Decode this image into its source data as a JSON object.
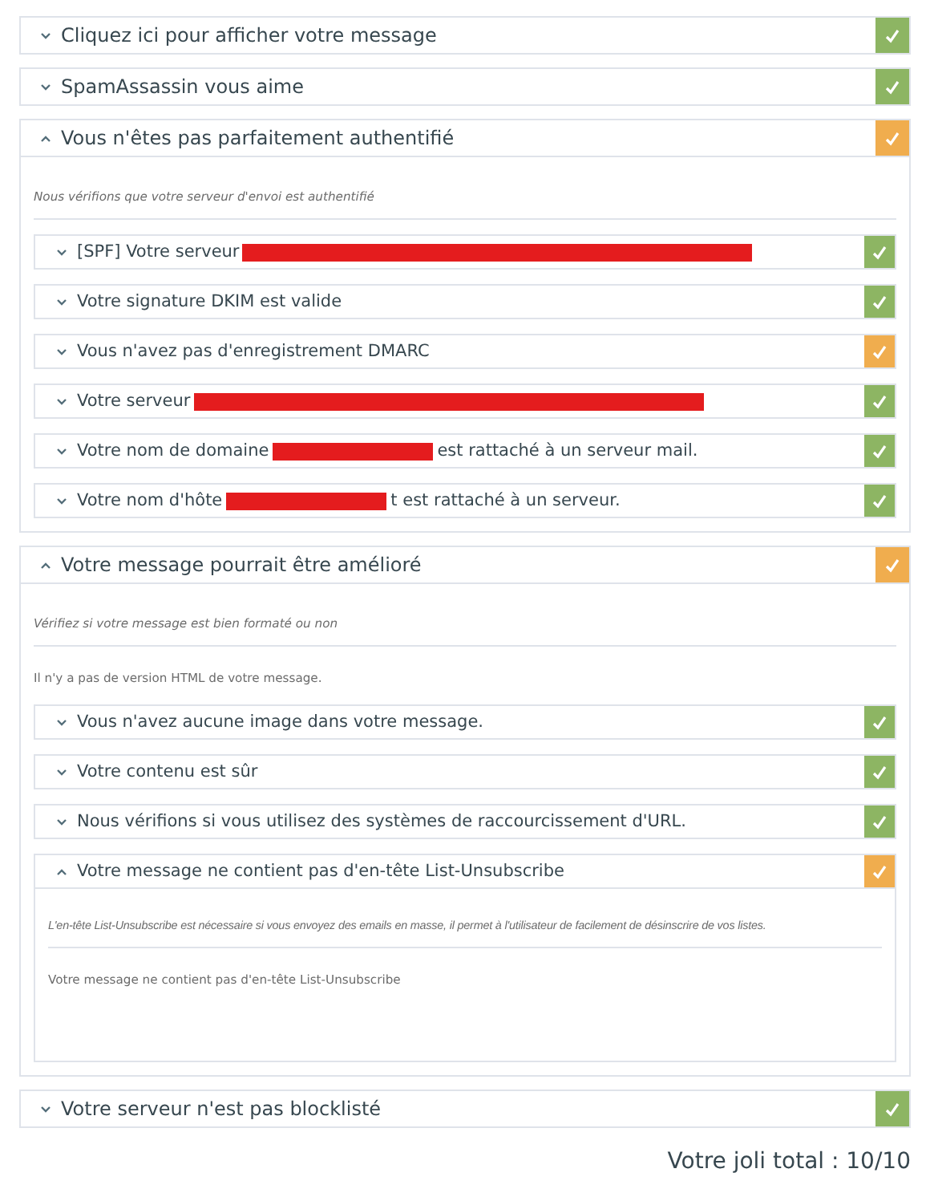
{
  "sections": [
    {
      "title": "Cliquez ici pour afficher votre message",
      "expanded": false,
      "color": "#8db563"
    },
    {
      "title": "SpamAssassin vous aime",
      "expanded": false,
      "color": "#8db563"
    },
    {
      "title": "Vous n'êtes pas parfaitement authentifié",
      "expanded": true,
      "color": "#f0ad4e",
      "description": "Nous vérifions que votre serveur d'envoi est authentifié",
      "checks": [
        {
          "label": "[SPF] Votre serveur",
          "redacted": true,
          "expanded": false,
          "color": "#8db563"
        },
        {
          "label": "Votre signature DKIM est valide",
          "expanded": false,
          "color": "#8db563"
        },
        {
          "label": "Vous n'avez pas d'enregistrement DMARC",
          "expanded": false,
          "color": "#f0ad4e"
        },
        {
          "label": "Votre serveur",
          "redacted": true,
          "expanded": false,
          "color": "#8db563"
        },
        {
          "label": "Votre nom de domaine",
          "redacted": true,
          "after": "est rattaché à un serveur mail.",
          "expanded": false,
          "color": "#8db563"
        },
        {
          "label": "Votre nom d'hôte",
          "redacted": true,
          "after": "t est rattaché à un serveur.",
          "expanded": false,
          "color": "#8db563"
        }
      ]
    },
    {
      "title": "Votre message pourrait être amélioré",
      "expanded": true,
      "color": "#f0ad4e",
      "description": "Vérifiez si votre message est bien formaté ou non",
      "note": "Il n'y a pas de version HTML de votre message.",
      "checks": [
        {
          "label": "Vous n'avez aucune image dans votre message.",
          "expanded": false,
          "color": "#8db563"
        },
        {
          "label": "Votre contenu est sûr",
          "expanded": false,
          "color": "#8db563"
        },
        {
          "label": "Nous vérifions si vous utilisez des systèmes de raccourcissement d'URL.",
          "expanded": false,
          "color": "#8db563"
        },
        {
          "label": "Votre message ne contient pas d'en-tête List-Unsubscribe",
          "expanded": true,
          "color": "#f0ad4e",
          "description": "L'en-tête List-Unsubscribe est nécessaire si vous envoyez des emails en masse, il permet à l'utilisateur de facilement de désinscrire de vos listes.",
          "note": "Votre message ne contient pas d'en-tête List-Unsubscribe"
        }
      ]
    },
    {
      "title": "Votre serveur n'est pas blocklisté",
      "expanded": false,
      "color": "#8db563"
    }
  ],
  "total": "Votre joli total : 10/10"
}
